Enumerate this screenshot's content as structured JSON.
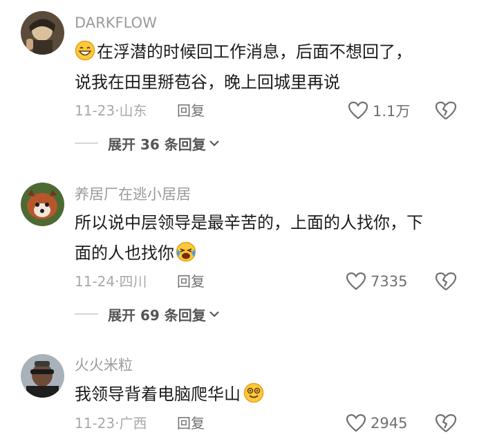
{
  "comments": [
    {
      "username": "DARKFLOW",
      "text_line1": "在浮潜的时候回工作消息，后面不想回了，",
      "text_line2": "说我在田里掰苞谷，晚上回城里再说",
      "time": "11-23",
      "location": "山东",
      "reply_label": "回复",
      "likes": "1.1万",
      "expand_label": "展开 36 条回复",
      "avatar_colors": [
        "#6b5a45",
        "#2d2a25"
      ],
      "emoji": "grin-icon"
    },
    {
      "username": "养居厂在逃小居居",
      "text_line1": "所以说中层领导是最辛苦的，上面的人找你，下",
      "text_line2": "面的人也找你",
      "time": "11-24",
      "location": "四川",
      "reply_label": "回复",
      "likes": "7335",
      "expand_label": "展开 69 条回复",
      "avatar_colors": [
        "#b6542a",
        "#3d5a2c"
      ],
      "emoji": "crying-laugh-icon"
    },
    {
      "username": "火火米粒",
      "text_line1": "我领导背着电脑爬华山",
      "time": "11-23",
      "location": "广西",
      "reply_label": "回复",
      "likes": "2945",
      "avatar_colors": [
        "#6d4b36",
        "#1e1e1e"
      ],
      "emoji": "dizzy-smile-icon"
    }
  ],
  "colors": {
    "emoji_yellow": "#ffc93a",
    "emoji_outline": "#e0a21f",
    "tear_blue": "#3aa0ff"
  }
}
